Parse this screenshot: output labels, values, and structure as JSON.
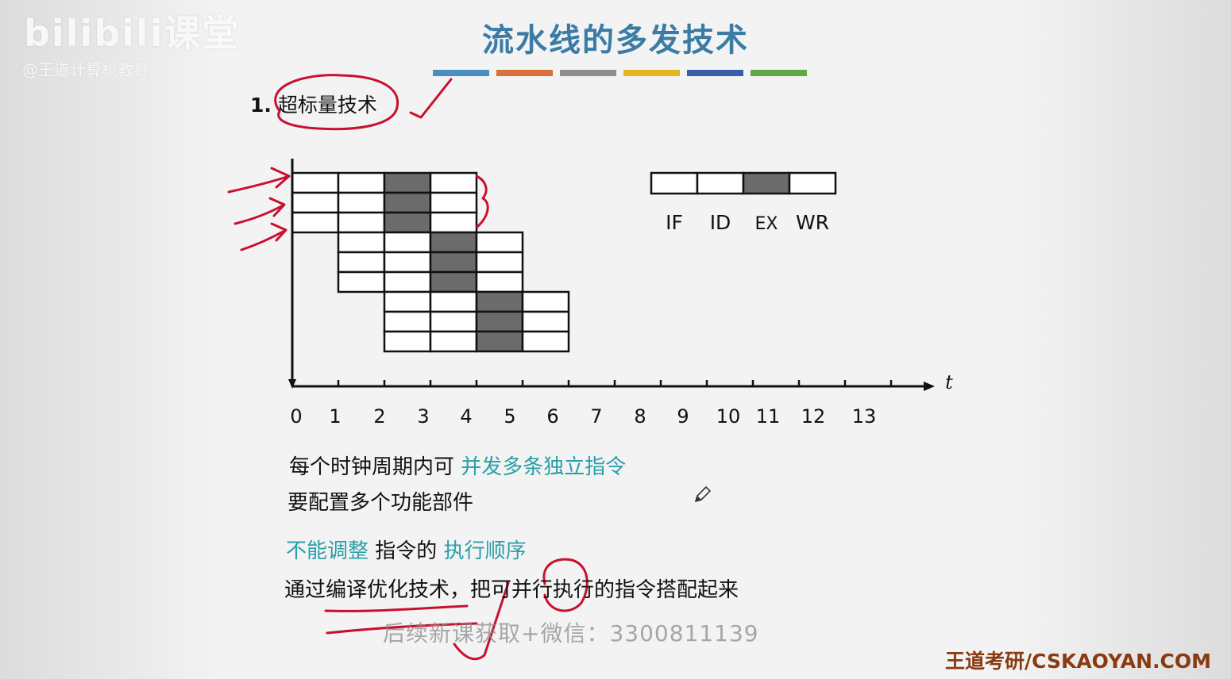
{
  "watermark": {
    "logo": "bilibili课堂",
    "sub": "@王道计算机教育"
  },
  "title": "流水线的多发技术",
  "color_bars": [
    "#4a8ec2",
    "#d8703a",
    "#8f8f8f",
    "#e6b71e",
    "#3a5fa8",
    "#62a844"
  ],
  "section": {
    "number": "1.",
    "label": "超标量技术"
  },
  "diagram": {
    "legend_stages": [
      "IF",
      "ID",
      "EX",
      "WR"
    ],
    "axis_label": "t",
    "tick_labels": [
      "0",
      "1",
      "2",
      "3",
      "4",
      "5",
      "6",
      "7",
      "8",
      "9",
      "10",
      "11",
      "12",
      "13"
    ],
    "groups": 3,
    "instructions_per_group": 3,
    "shaded_stage": "EX"
  },
  "lines": {
    "l1_a": "每个时钟周期内可",
    "l1_b": "并发多条独立指令",
    "l2": "要配置多个功能部件",
    "l3_a": "不能调整",
    "l3_b": "指令的",
    "l3_c": "执行顺序",
    "l4": "通过编译优化技术，把可并行执行的指令搭配起来"
  },
  "overlay": {
    "wechat": "后续新课获取+微信：3300811139",
    "brand": "王道考研/CSKAOYAN.COM"
  }
}
